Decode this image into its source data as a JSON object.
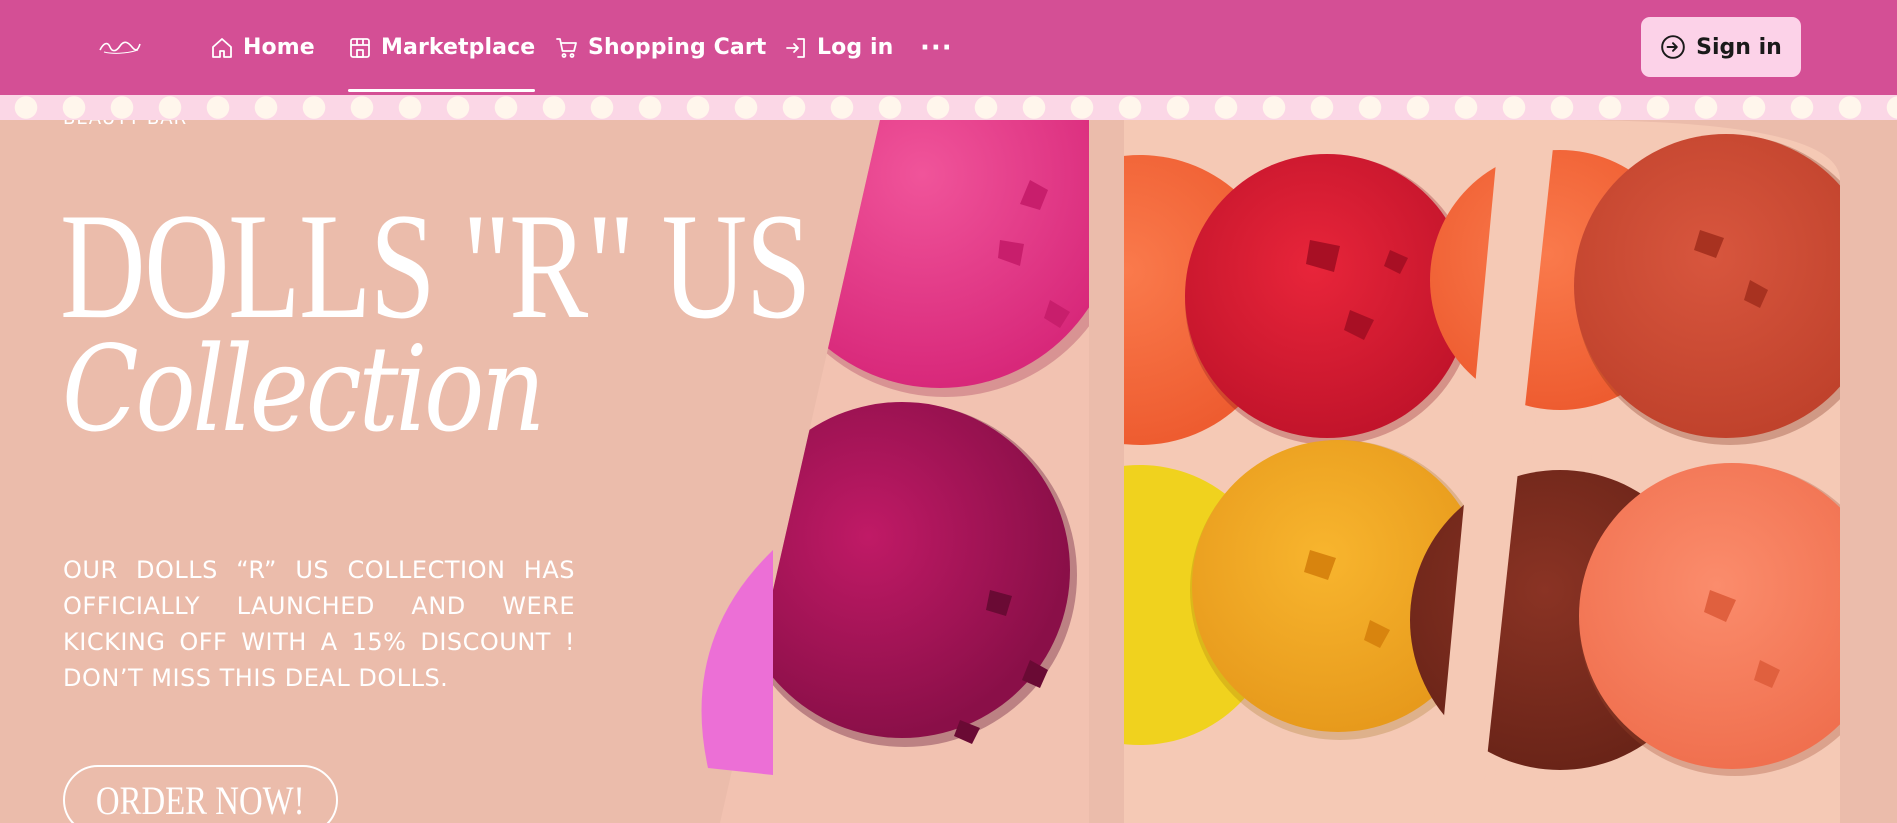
{
  "nav": {
    "logo_icon": "brand-script-logo-icon",
    "items": [
      {
        "label": "Home",
        "icon": "home-icon",
        "active": false
      },
      {
        "label": "Marketplace",
        "icon": "store-icon",
        "active": true
      },
      {
        "label": "Shopping Cart",
        "icon": "cart-icon",
        "active": false
      },
      {
        "label": "Log in",
        "icon": "login-icon",
        "active": false
      }
    ],
    "more_label": "···",
    "signin_label": "Sign in"
  },
  "hero": {
    "cut_label": "BEAUTY BAR",
    "title": "DOLLS \"R\" US",
    "subtitle": "Collection",
    "description": "OUR DOLLS “R” US COLLECTION HAS OFFICIALLY LAUNCHED AND WERE KICKING OFF WITH A 15% DISCOUNT ! DON’T MISS THIS DEAL DOLLS.",
    "cta_label": "ORDER NOW!"
  },
  "colors": {
    "nav_bg": "#d44f95",
    "signin_bg": "#fcd2e8",
    "hero_bg": "#ebbcab",
    "polka_bg": "#fbd7e6",
    "polka_dot": "#fff6ec"
  }
}
